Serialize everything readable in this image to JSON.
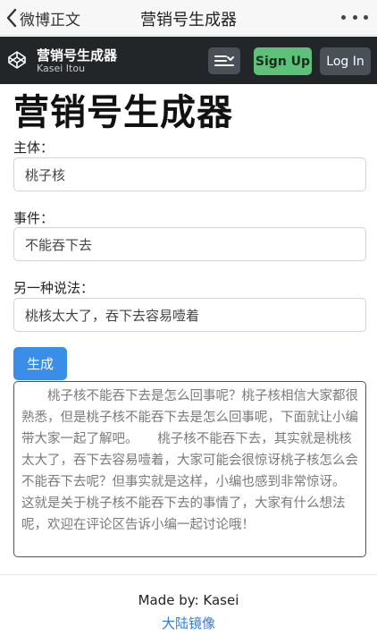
{
  "topbar": {
    "back_label": "微博正文",
    "title": "营销号生成器"
  },
  "nav": {
    "brand_title": "营销号生成器",
    "brand_sub": "Kasei Itou",
    "signup": "Sign Up",
    "login": "Log In"
  },
  "main": {
    "title": "营销号生成器",
    "subject": {
      "label": "主体：",
      "value": "桃子核"
    },
    "event": {
      "label": "事件：",
      "value": "不能吞下去"
    },
    "alt": {
      "label": "另一种说法：",
      "value": "桃核太大了，吞下去容易噎着"
    },
    "generate_label": "生成",
    "output": "　　桃子核不能吞下去是怎么回事呢？桃子核相信大家都很熟悉，但是桃子核不能吞下去是怎么回事呢，下面就让小编带大家一起了解吧。　　桃子核不能吞下去，其实就是桃核太大了，吞下去容易噎着，大家可能会很惊讶桃子核怎么会不能吞下去呢？但事实就是这样，小编也感到非常惊讶。\n这就是关于桃子核不能吞下去的事情了，大家有什么想法呢，欢迎在评论区告诉小编一起讨论哦！"
  },
  "footer": {
    "made_by": "Made by: Kasei",
    "link": "大陆镜像"
  },
  "colors": {
    "navbar": "#232629",
    "signup": "#5ec17a",
    "primary": "#3a8ee8",
    "link": "#2e7ae0"
  }
}
